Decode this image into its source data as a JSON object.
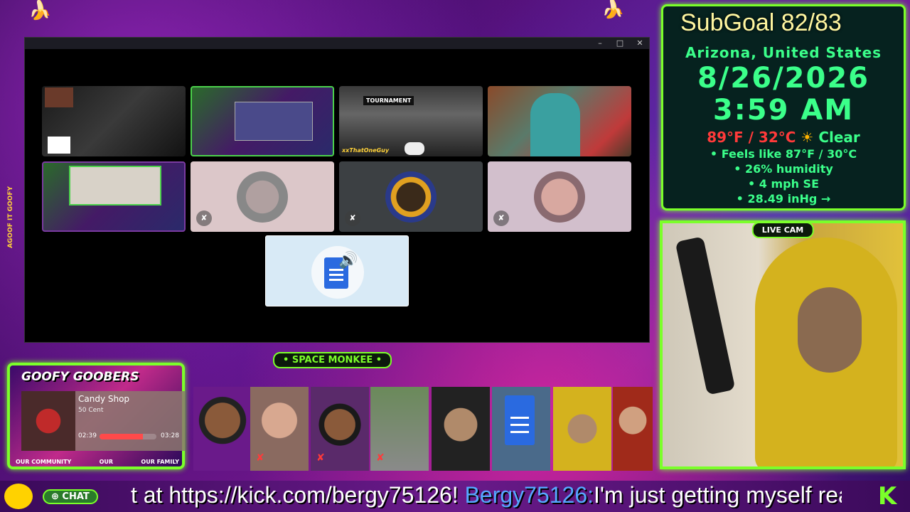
{
  "window": {
    "controls": [
      "–",
      "□",
      "✕"
    ]
  },
  "tiles": {
    "tournament_label": "TOURNAMENT",
    "tournament_brand": "xxThatOneGuy"
  },
  "info": {
    "subgoal": "SubGoal 82/83",
    "location": "Arizona, United States",
    "date": "8/26/2026",
    "time": "3:59 AM",
    "temperature": "89°F / 32°C",
    "condition": "Clear",
    "feels_like": "• Feels like 87°F / 30°C",
    "humidity": "• 26% humidity",
    "wind": "• 4 mph SE",
    "pressure": "• 28.49 inHg →"
  },
  "live_cam": {
    "label": "LIVE CAM"
  },
  "space_monkee": {
    "title": "• SPACE MONKEE •"
  },
  "goobers": {
    "title": "GOOFY GOOBERS",
    "footer_left": "OUR COMMUNITY",
    "footer_mid": "OUR",
    "footer_right": "OUR FAMILY"
  },
  "music": {
    "song": "Candy Shop",
    "artist": "50 Cent",
    "elapsed": "02:39",
    "duration": "03:28",
    "progress": 0.76
  },
  "ticker": {
    "chat_label": "⊕ CHAT",
    "text_before": "t at https://kick.com/bergy75126! ",
    "user": "Bergy75126:",
    "message": "I'm just getting myself ready for work"
  },
  "side_text": "AGOOF IT GOOFY",
  "colors": {
    "neon_green": "#7bff2a",
    "info_green": "#3bff8a",
    "temp_red": "#ff3a3a"
  },
  "icons": [
    "mic-off-icon",
    "doc-speaker-icon",
    "sun-icon",
    "kick-logo-icon"
  ]
}
